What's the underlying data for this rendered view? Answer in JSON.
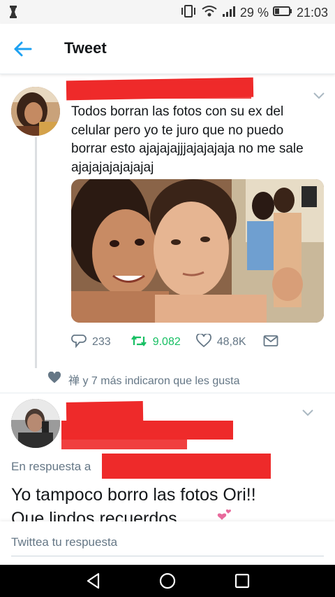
{
  "status_bar": {
    "battery_percent": "29 %",
    "time": "21:03",
    "icons": [
      "notification-icon",
      "vibrate-icon",
      "wifi-icon",
      "signal-icon",
      "battery-icon"
    ]
  },
  "header": {
    "title": "Tweet",
    "back_icon": "arrow-left-icon"
  },
  "tweet": {
    "text": "Todos borran las fotos con su ex del celular pero yo te juro que no puedo borrar esto ajajajajjjajajajaja no me sale ajajajajajajajaj",
    "stats": {
      "replies": "233",
      "retweets": "9.082",
      "likes": "48,8K"
    },
    "liked_by": "禅 y 7 más indicaron que les gusta"
  },
  "reply": {
    "in_reply_prefix": "En respuesta a",
    "text_line1": "Yo tampoco borro las fotos Ori!!",
    "text_line2": "Que lindos recuerdos"
  },
  "compose": {
    "placeholder": "Twittea tu respuesta"
  },
  "colors": {
    "accent": "#1da1f2",
    "retweet": "#17bf63",
    "muted": "#657786",
    "redaction": "#ee2a2a"
  }
}
